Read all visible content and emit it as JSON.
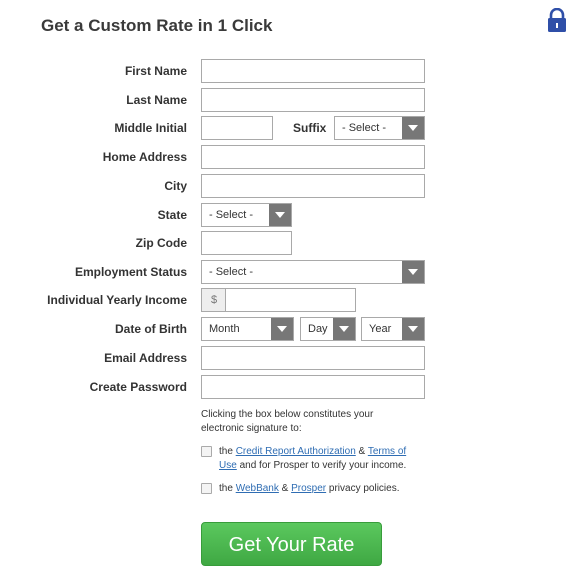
{
  "header": {
    "title": "Get a Custom Rate in 1 Click",
    "lock_icon": "lock-icon"
  },
  "colors": {
    "accent_blue": "#2f4fa8",
    "link": "#2f6db3",
    "cta_green": "#4db851",
    "select_arrow_bg": "#777777"
  },
  "form": {
    "first_name_label": "First Name",
    "last_name_label": "Last Name",
    "middle_initial_label": "Middle Initial",
    "suffix_label": "Suffix",
    "suffix_value": "- Select -",
    "home_address_label": "Home Address",
    "city_label": "City",
    "state_label": "State",
    "state_value": "- Select -",
    "zip_label": "Zip Code",
    "employment_label": "Employment Status",
    "employment_value": "- Select -",
    "income_label": "Individual Yearly Income",
    "income_prefix": "$",
    "dob_label": "Date of Birth",
    "dob_month": "Month",
    "dob_day": "Day",
    "dob_year": "Year",
    "email_label": "Email Address",
    "password_label": "Create Password"
  },
  "consent": {
    "intro": "Clicking the box below constitutes your electronic signature to:",
    "item1_the": "the",
    "item1_link1": "Credit Report Authorization",
    "item1_amp": "&",
    "item1_link2": "Terms of Use",
    "item1_rest": "and for Prosper to verify your income.",
    "item2_the": "the",
    "item2_link1": "WebBank",
    "item2_amp": "&",
    "item2_link2": "Prosper",
    "item2_rest": "privacy policies."
  },
  "cta": {
    "label": "Get Your Rate"
  }
}
